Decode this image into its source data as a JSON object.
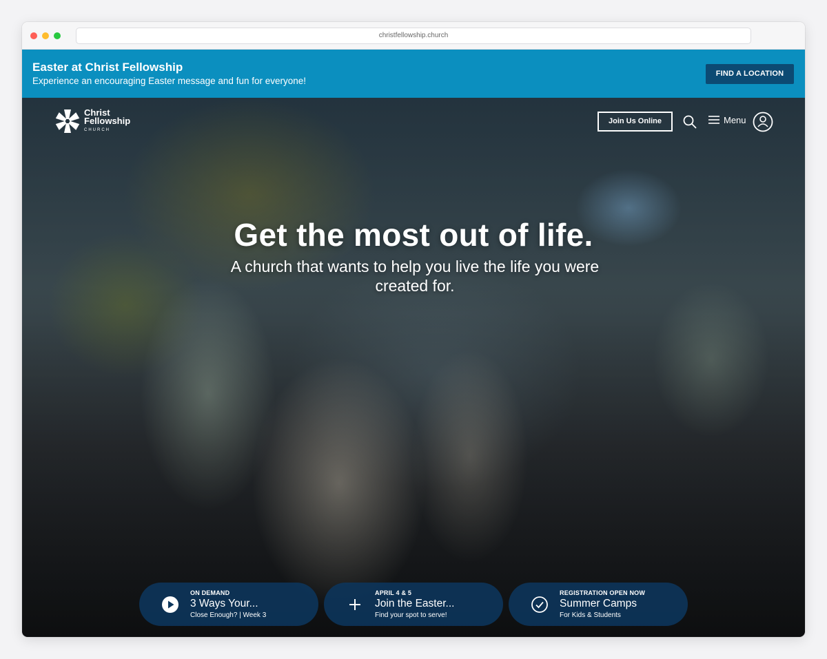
{
  "browser": {
    "url": "christfellowship.church"
  },
  "banner": {
    "title": "Easter at Christ Fellowship",
    "subtitle": "Experience an encouraging Easter message and fun for everyone!",
    "button": "FIND A LOCATION",
    "background_color": "#0b8fbf",
    "button_color": "#0c4a73"
  },
  "header": {
    "logo": {
      "line1": "Christ",
      "line2": "Fellowship",
      "line3": "CHURCH"
    },
    "join_online": "Join Us Online",
    "menu_label": "Menu",
    "icons": [
      "search-icon",
      "hamburger-icon",
      "account-icon"
    ]
  },
  "hero": {
    "headline": "Get the most out of life.",
    "subheadline": "A church that wants to help you live the life you were created for."
  },
  "cards": [
    {
      "kicker": "ON DEMAND",
      "title": "3 Ways Your...",
      "subtitle": "Close Enough? | Week 3",
      "icon": "play-icon"
    },
    {
      "kicker": "APRIL 4 & 5",
      "title": "Join the Easter...",
      "subtitle": "Find your spot to serve!",
      "icon": "plus-icon"
    },
    {
      "kicker": "REGISTRATION OPEN NOW",
      "title": "Summer Camps",
      "subtitle": "For Kids & Students",
      "icon": "check-circle-icon"
    }
  ]
}
